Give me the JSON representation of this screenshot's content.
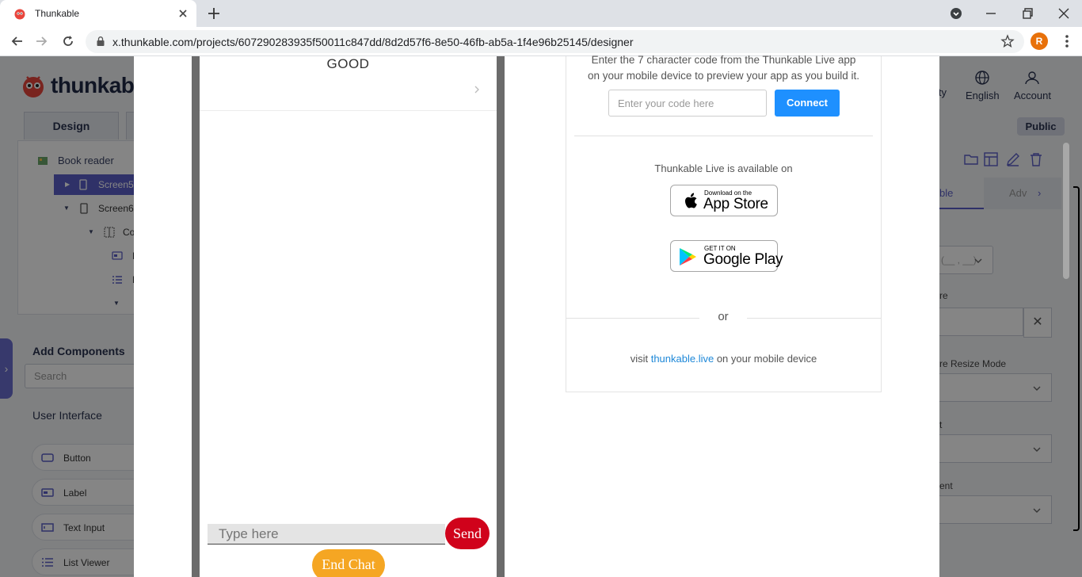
{
  "browser": {
    "tab_title": "Thunkable",
    "url": "x.thunkable.com/projects/607290283935f50011c847dd/8d2d57f6-8e50-46fb-ab5a-1f4e96b25145/designer",
    "profile_initial": "R"
  },
  "app": {
    "logo_text": "thunkable",
    "tabs": {
      "design": "Design"
    },
    "tree": {
      "project": "Book reader",
      "items": [
        {
          "label": "Screen5"
        },
        {
          "label": "Screen6"
        },
        {
          "label": "Col"
        },
        {
          "label": "La"
        },
        {
          "label": "Li"
        }
      ]
    },
    "add_components": "Add Components",
    "search_placeholder": "Search",
    "ui_heading": "User Interface",
    "components": [
      {
        "label": "Button",
        "icon": "button-icon"
      },
      {
        "label": "Label",
        "icon": "label-icon"
      },
      {
        "label": "Text Input",
        "icon": "text-input-icon"
      },
      {
        "label": "List Viewer",
        "icon": "list-viewer-icon"
      }
    ],
    "top_nav": {
      "community": "ity",
      "language": "English",
      "account": "Account"
    },
    "public_badge": "Public",
    "prop_tabs": {
      "basic": "ble",
      "advanced": "Adv"
    },
    "prop_fields": {
      "picture_label": "re",
      "resize_label": "re Resize Mode",
      "field3_label": "t",
      "field4_label": "ent",
      "first_select": "(__ , __)"
    }
  },
  "preview": {
    "message": "GOOD",
    "input_placeholder": "Type here",
    "send_label": "Send",
    "end_chat_label": "End Chat"
  },
  "live": {
    "instruction_line1": "Enter the 7 character code from the Thunkable Live app",
    "instruction_line2": "on your mobile device to preview your app as you build it.",
    "code_placeholder": "Enter your code here",
    "connect_label": "Connect",
    "available": "Thunkable Live is available on",
    "app_store_small": "Download on the",
    "app_store_big": "App Store",
    "google_small": "GET IT ON",
    "google_big": "Google Play",
    "or": "or",
    "visit_prefix": "visit ",
    "visit_link": "thunkable.live",
    "visit_suffix": " on your mobile device"
  },
  "colors": {
    "accent_blue": "#1e90ff",
    "send_red": "#d0021b",
    "end_chat_orange": "#f5a623",
    "tree_selected": "#5b5fc7"
  }
}
